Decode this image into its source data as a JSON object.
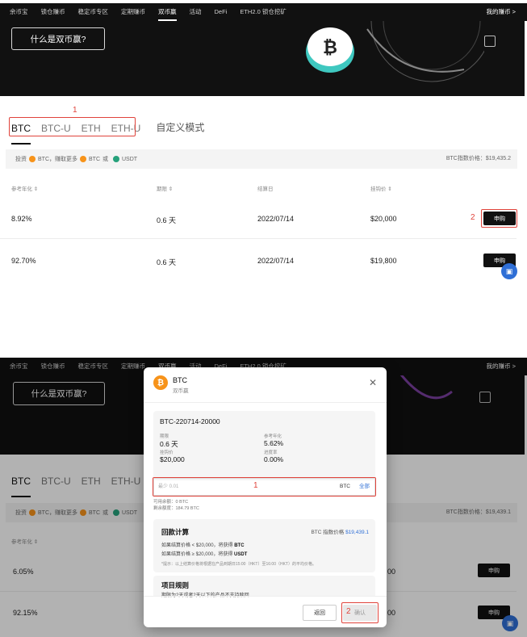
{
  "nav": {
    "items": [
      "余币宝",
      "锁仓赚币",
      "稳定币专区",
      "定期赚币",
      "双币赢",
      "活动",
      "DeFi",
      "ETH2.0 锁仓挖矿"
    ],
    "active_index": 4,
    "right": "我的赚币 >"
  },
  "hero": {
    "button": "什么是双币赢?"
  },
  "tabs": [
    "BTC",
    "BTC-U",
    "ETH",
    "ETH-U"
  ],
  "custom_tab": "自定义模式",
  "info": {
    "invest_prefix": "投资",
    "coin1": "BTC",
    "earn_text": "，赚取更多",
    "coin2": "BTC",
    "or_text": "或",
    "coin3": "USDT",
    "price_top": "BTC指数价格：$19,435.2",
    "price_bottom": "BTC指数价格：$19,439.1"
  },
  "table": {
    "headers": [
      "参考年化 ⇕",
      "期限 ⇕",
      "结算日",
      "挂钩价 ⇕"
    ],
    "buy_label": "申购",
    "rows_top": [
      {
        "apy": "8.92%",
        "term": "0.6 天",
        "date": "2022/07/14",
        "price": "$20,000"
      },
      {
        "apy": "92.70%",
        "term": "0.6 天",
        "date": "2022/07/14",
        "price": "$19,800"
      }
    ],
    "rows_bottom": [
      {
        "apy": "6.05%",
        "price_tail": "00"
      },
      {
        "apy": "92.15%",
        "price_tail": "00"
      }
    ]
  },
  "annotations": {
    "one": "1",
    "two": "2"
  },
  "modal": {
    "title": "BTC",
    "subtitle": "双币赢",
    "product_id": "BTC-220714-20000",
    "term_label": "期限",
    "term_value": "0.6 天",
    "apy_label": "参考年化",
    "apy_value": "5.62%",
    "price_label": "挂钩价",
    "price_value": "$20,000",
    "progress_label": "进度率",
    "progress_value": "0.00%",
    "input_placeholder": "最少 0.01",
    "input_unit": "BTC",
    "input_all": "全部",
    "available": "可用余额：0 BTC",
    "remaining": "剩余额度：184.79 BTC",
    "calc_title": "回款计算",
    "calc_price_label": "BTC 指数价格",
    "calc_price_value": "$19,439.1",
    "calc_line1_pre": "如果结算价格 < $20,000，将获得",
    "calc_line1_coin": "BTC",
    "calc_line2_pre": "如果结算价格 ≥ $20,000，将获得",
    "calc_line2_coin": "USDT",
    "calc_note": "*提示：以上结算价格将根据在产品到期日15:00（HKT）至16:00（HKT）的平均价格。",
    "redeem_title": "项目规则",
    "redeem_text": "期限为2天或者2天以下的产品不支持赎回",
    "btn_back": "返回",
    "btn_ok": "确认"
  }
}
